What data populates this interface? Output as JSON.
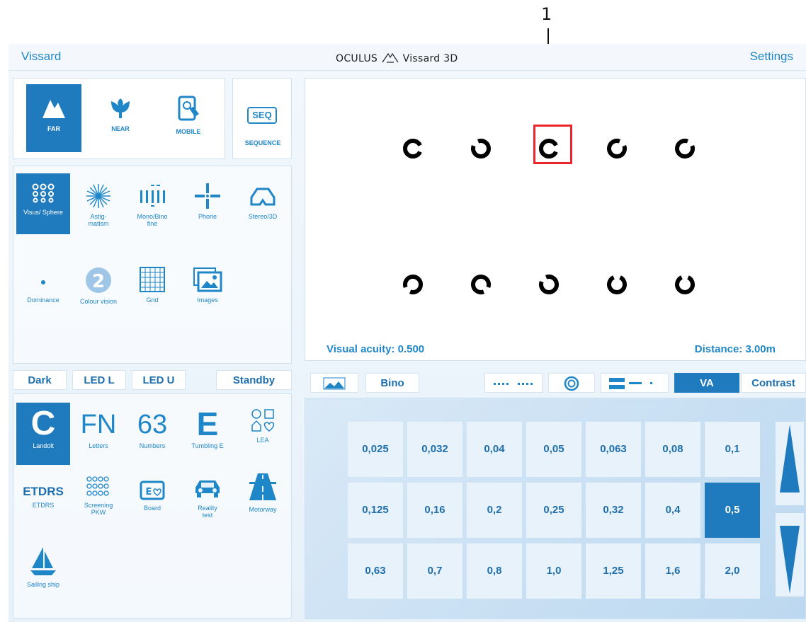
{
  "callout": {
    "number": "1"
  },
  "topbar": {
    "left": "Vissard",
    "center": "OCULUS",
    "center_suffix": "Vissard 3D",
    "right": "Settings"
  },
  "modes": [
    {
      "label": "FAR",
      "icon": "mountain-icon",
      "active": true
    },
    {
      "label": "NEAR",
      "icon": "tulip-icon"
    },
    {
      "label": "MOBILE",
      "icon": "tablet-touch-icon"
    }
  ],
  "sequence": {
    "badge": "SEQ",
    "label": "SEQUENCE"
  },
  "tests_row1": [
    {
      "label": "Visus/ Sphere",
      "icon": "landolt-grid-icon",
      "active": true
    },
    {
      "label": "Astig-\nmatism",
      "icon": "sunburst-icon"
    },
    {
      "label": "Mono/Bino\nfine",
      "icon": "bars-icon"
    },
    {
      "label": "Phorie",
      "icon": "cross-icon"
    },
    {
      "label": "Stereo/3D",
      "icon": "glasses-icon"
    }
  ],
  "tests_row2": [
    {
      "label": "Dominance",
      "icon": "dot-icon"
    },
    {
      "label": "Colour vision",
      "icon": "ishihara-icon"
    },
    {
      "label": "Grid",
      "icon": "grid-icon"
    },
    {
      "label": "Images",
      "icon": "images-icon"
    }
  ],
  "display": {
    "visual_acuity": "Visual acuity: 0.500",
    "distance": "Distance: 3.00m"
  },
  "left_tabs": {
    "dark": "Dark",
    "led_l": "LED L",
    "led_u": "LED U",
    "standby": "Standby"
  },
  "optotypes": [
    {
      "label": "Landolt",
      "glyph": "C",
      "active": true
    },
    {
      "label": "Letters",
      "glyph": "FN"
    },
    {
      "label": "Numbers",
      "glyph": "63"
    },
    {
      "label": "Tumbling E",
      "glyph": "E"
    },
    {
      "label": "LEA",
      "glyph": "lea-icon"
    },
    {
      "label": "ETDRS",
      "glyph": "ETDRS"
    },
    {
      "label": "Screening\nPKW",
      "glyph": "rings-icon"
    },
    {
      "label": "Board",
      "glyph": "board-icon"
    },
    {
      "label": "Reality\ntest",
      "glyph": "car-icon"
    },
    {
      "label": "Motorway",
      "glyph": "road-icon"
    },
    {
      "label": "Sailing ship",
      "glyph": "sailboat-icon"
    }
  ],
  "right_toolbar": {
    "bino": "Bino",
    "va": "VA",
    "contrast": "Contrast"
  },
  "va_values": [
    [
      "0,025",
      "0,032",
      "0,04",
      "0,05",
      "0,063",
      "0,08",
      "0,1"
    ],
    [
      "0,125",
      "0,16",
      "0,2",
      "0,25",
      "0,32",
      "0,4",
      "0,5"
    ],
    [
      "0,63",
      "0,7",
      "0,8",
      "1,0",
      "1,25",
      "1,6",
      "2,0"
    ]
  ],
  "selected_va": "0,5",
  "colors": {
    "accent": "#1f7bbd",
    "callout": "#e8262b"
  }
}
